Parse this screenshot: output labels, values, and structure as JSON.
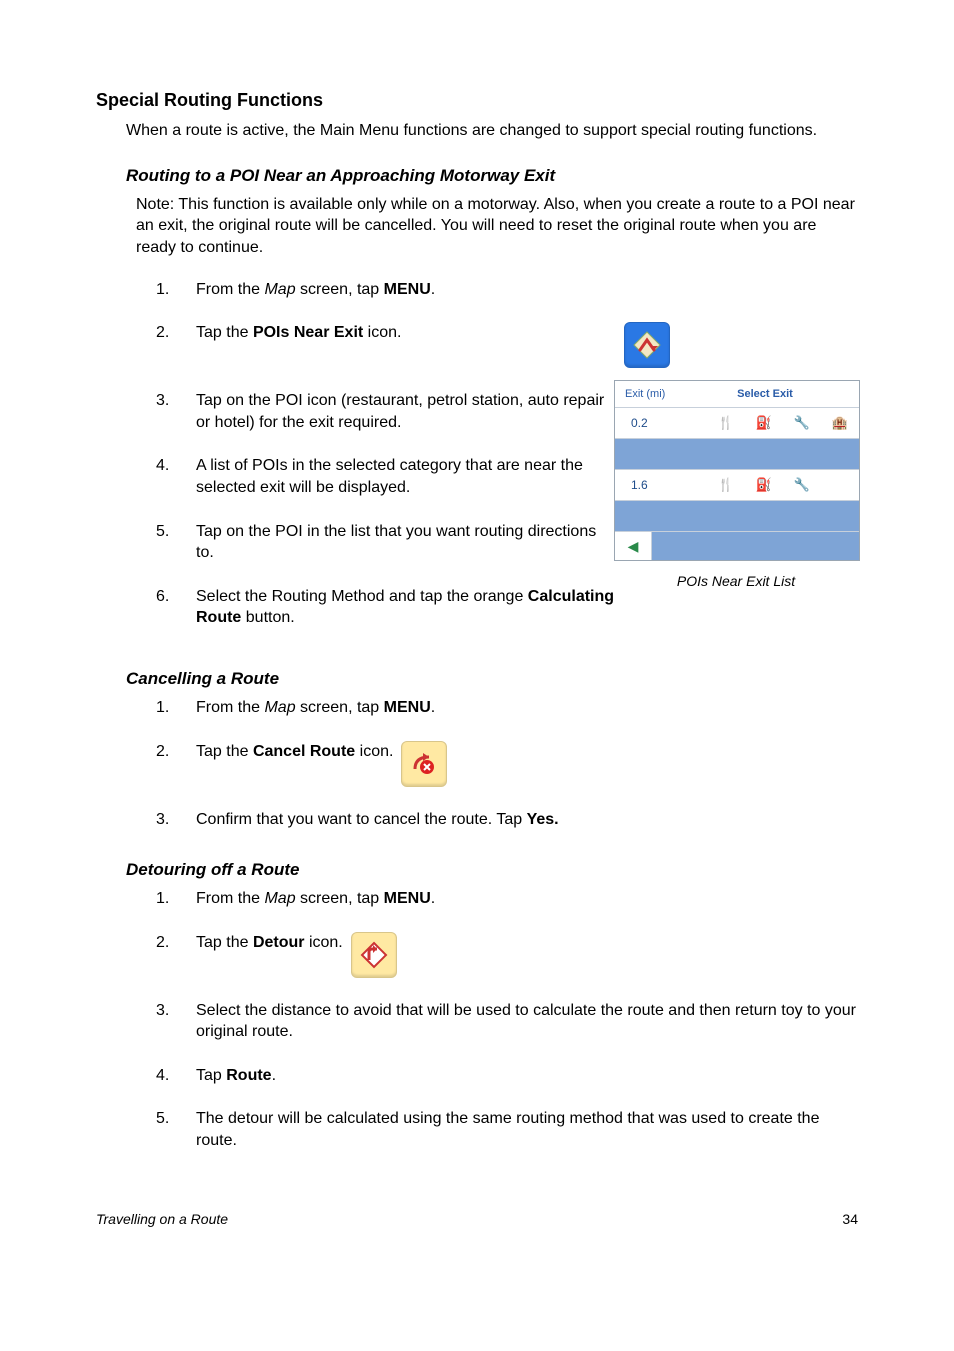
{
  "headings": {
    "section": "Special Routing Functions",
    "intro": "When a route is active, the Main Menu functions are changed to support special routing functions.",
    "poi_motorway": "Routing to a POI Near an Approaching Motorway Exit",
    "poi_note": "Note: This function is available only while on a motorway.  Also, when you create a route to a POI near an exit, the original route will be cancelled.  You will need to reset the original route when you are ready to continue.",
    "cancel_route": "Cancelling a Route",
    "detour_route": "Detouring off a Route"
  },
  "poi_steps": {
    "s1_a": "From the ",
    "s1_b": "Map",
    "s1_c": " screen, tap ",
    "s1_d": "MENU",
    "s1_e": ".",
    "s2_a": "Tap the ",
    "s2_b": "POIs Near Exit",
    "s2_c": " icon.",
    "s3": "Tap on the POI icon (restaurant, petrol station, auto repair or hotel) for the exit required.",
    "s4": "A list of POIs in the selected category that are near the selected exit will be displayed.",
    "s5": "Tap on the POI in the list that you want routing directions to.",
    "s6_a": "Select the Routing Method and tap the orange ",
    "s6_b": "Calculating Route",
    "s6_c": " button."
  },
  "cancel_steps": {
    "s1_a": "From the ",
    "s1_b": "Map",
    "s1_c": " screen, tap ",
    "s1_d": "MENU",
    "s1_e": ".",
    "s2_a": "Tap the ",
    "s2_b": "Cancel Route",
    "s2_c": " icon.",
    "s3_a": "Confirm that you want to cancel the route.  Tap ",
    "s3_b": "Yes."
  },
  "detour_steps": {
    "s1_a": "From the ",
    "s1_b": "Map",
    "s1_c": " screen, tap ",
    "s1_d": "MENU",
    "s1_e": ".",
    "s2_a": "Tap the ",
    "s2_b": "Detour",
    "s2_c": " icon.",
    "s3": "Select the distance to avoid that will be used to calculate the route and then return toy to your original route.",
    "s4_a": "Tap ",
    "s4_b": "Route",
    "s4_c": ".",
    "s5": "The detour will be calculated using the same routing method that was used to create the route."
  },
  "figure": {
    "header_left": "Exit   (mi)",
    "header_title": "Select Exit",
    "row1_dist": "0.2",
    "row2_dist": "1.6",
    "caption": "POIs Near Exit List"
  },
  "footer": {
    "chapter": "Travelling on a Route",
    "page_number": "34"
  },
  "icons": {
    "fork": "🍴",
    "fuel": "⛽",
    "wrench": "🔧",
    "hotel": "🏨",
    "back": "◀"
  }
}
